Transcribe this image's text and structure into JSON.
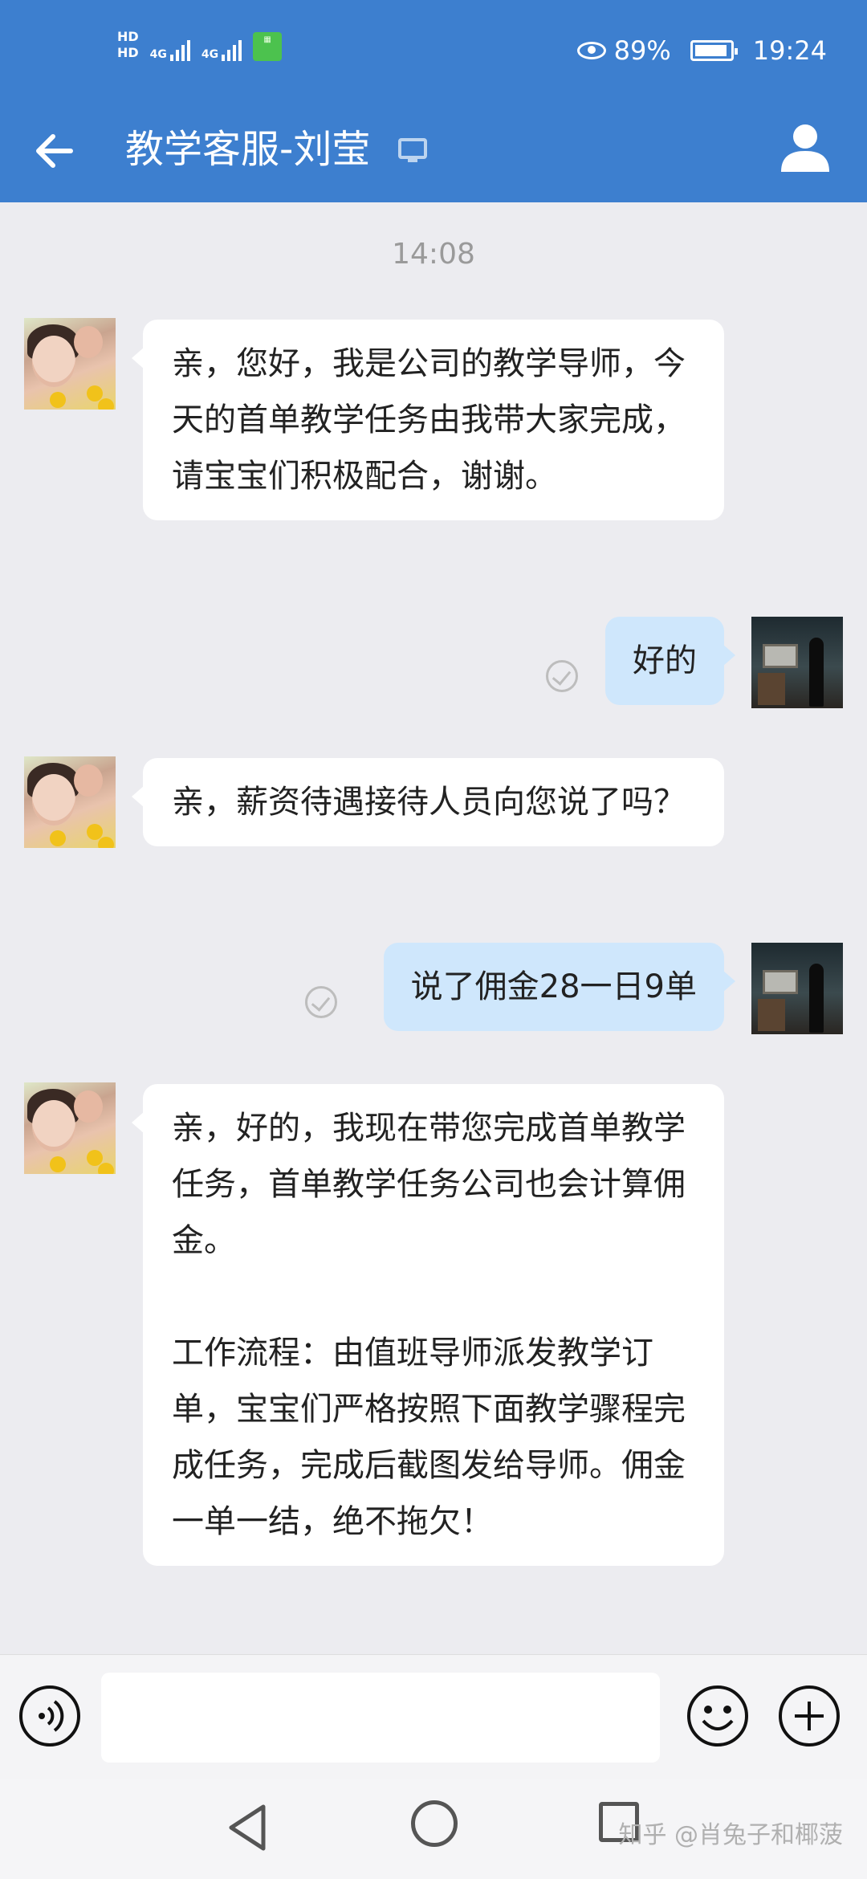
{
  "status_bar": {
    "hd1": "HD",
    "hd2": "HD",
    "signal1": "4G",
    "signal2": "4G",
    "battery_percent": "89%",
    "time": "19:24"
  },
  "header": {
    "title": "教学客服-刘莹"
  },
  "chat": {
    "timestamp": "14:08",
    "messages": [
      {
        "side": "incoming",
        "text": "亲，您好，我是公司的教学导师，今天的首单教学任务由我带大家完成，请宝宝们积极配合，谢谢。"
      },
      {
        "side": "outgoing",
        "text": "好的",
        "status": "read"
      },
      {
        "side": "incoming",
        "text": "亲，薪资待遇接待人员向您说了吗？"
      },
      {
        "side": "outgoing",
        "text": "说了佣金28一日9单",
        "status": "read"
      },
      {
        "side": "incoming",
        "para1": "亲，好的，我现在带您完成首单教学任务，首单教学任务公司也会计算佣金。",
        "para2": "工作流程：由值班导师派发教学订单，宝宝们严格按照下面教学骤程完成任务，完成后截图发给导师。佣金一单一结，绝不拖欠！"
      }
    ]
  },
  "input_bar": {
    "value": "",
    "placeholder": ""
  },
  "watermark": "知乎 @肖兔子和椰菠",
  "colors": {
    "header_bg": "#3d7fcf",
    "chat_bg": "#ececf0",
    "incoming_bubble": "#ffffff",
    "outgoing_bubble": "#cfe7fc"
  },
  "icons": [
    "back-arrow-icon",
    "computer-icon",
    "user-profile-icon",
    "voice-icon",
    "emoji-icon",
    "plus-icon",
    "read-check-icon",
    "nav-back-icon",
    "nav-home-icon",
    "nav-recent-icon"
  ]
}
